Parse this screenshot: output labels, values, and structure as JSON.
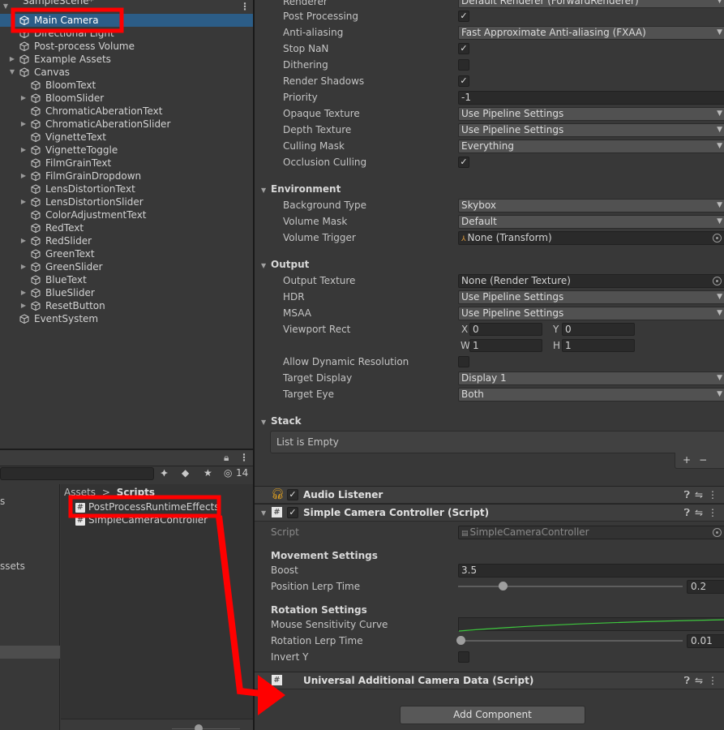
{
  "hierarchy": {
    "scene_name": "SampleScene*",
    "items": [
      {
        "label": "Main Camera"
      },
      {
        "label": "Directional Light"
      },
      {
        "label": "Post-process Volume"
      },
      {
        "label": "Example Assets"
      },
      {
        "label": "Canvas"
      },
      {
        "label": "BloomText"
      },
      {
        "label": "BloomSlider"
      },
      {
        "label": "ChromaticAberationText"
      },
      {
        "label": "ChromaticAberationSlider"
      },
      {
        "label": "VignetteText"
      },
      {
        "label": "VignetteToggle"
      },
      {
        "label": "FilmGrainText"
      },
      {
        "label": "FilmGrainDropdown"
      },
      {
        "label": "LensDistortionText"
      },
      {
        "label": "LensDistortionSlider"
      },
      {
        "label": "ColorAdjustmentText"
      },
      {
        "label": "RedText"
      },
      {
        "label": "RedSlider"
      },
      {
        "label": "GreenText"
      },
      {
        "label": "GreenSlider"
      },
      {
        "label": "BlueText"
      },
      {
        "label": "BlueSlider"
      },
      {
        "label": "ResetButton"
      },
      {
        "label": "EventSystem"
      }
    ]
  },
  "project": {
    "hidden_count": "14",
    "left_items": [
      "s",
      "ssets"
    ],
    "breadcrumb": {
      "root": "Assets",
      "sep": ">",
      "current": "Scripts"
    },
    "files": [
      "PostProcessRuntimeEffects",
      "SimpleCameraController"
    ]
  },
  "inspector": {
    "top_cut": "Default Renderer (ForwardRenderer)",
    "rendering": {
      "renderer_label": "Renderer",
      "post_processing": "Post Processing",
      "anti_aliasing": "Anti-aliasing",
      "anti_aliasing_value": "Fast Approximate Anti-aliasing (FXAA)",
      "stop_nan": "Stop NaN",
      "dithering": "Dithering",
      "render_shadows": "Render Shadows",
      "priority": "Priority",
      "priority_value": "-1",
      "opaque_texture": "Opaque Texture",
      "opaque_texture_value": "Use Pipeline Settings",
      "depth_texture": "Depth Texture",
      "depth_texture_value": "Use Pipeline Settings",
      "culling_mask": "Culling Mask",
      "culling_mask_value": "Everything",
      "occlusion_culling": "Occlusion Culling"
    },
    "environment": {
      "header": "Environment",
      "background_type": "Background Type",
      "background_type_value": "Skybox",
      "volume_mask": "Volume Mask",
      "volume_mask_value": "Default",
      "volume_trigger": "Volume Trigger",
      "volume_trigger_value": "None (Transform)"
    },
    "output": {
      "header": "Output",
      "output_texture": "Output Texture",
      "output_texture_value": "None (Render Texture)",
      "hdr": "HDR",
      "hdr_value": "Use Pipeline Settings",
      "msaa": "MSAA",
      "msaa_value": "Use Pipeline Settings",
      "viewport_rect": "Viewport Rect",
      "x": "X",
      "x_value": "0",
      "y": "Y",
      "y_value": "0",
      "w": "W",
      "w_value": "1",
      "h": "H",
      "h_value": "1",
      "allow_dynamic_resolution": "Allow Dynamic Resolution",
      "target_display": "Target Display",
      "target_display_value": "Display 1",
      "target_eye": "Target Eye",
      "target_eye_value": "Both"
    },
    "stack": {
      "header": "Stack",
      "empty_text": "List is Empty",
      "add": "+",
      "remove": "−"
    },
    "audio_listener": {
      "title": "Audio Listener"
    },
    "simple_camera": {
      "title": "Simple Camera Controller (Script)",
      "script_label": "Script",
      "script_value": "SimpleCameraController",
      "movement_settings": "Movement Settings",
      "boost": "Boost",
      "boost_value": "3.5",
      "position_lerp_time": "Position Lerp Time",
      "position_lerp_value": "0.2",
      "position_lerp_fraction": 0.2,
      "rotation_settings": "Rotation Settings",
      "mouse_sensitivity_curve": "Mouse Sensitivity Curve",
      "rotation_lerp_time": "Rotation Lerp Time",
      "rotation_lerp_value": "0.01",
      "rotation_lerp_fraction": 0.01,
      "invert_y": "Invert Y"
    },
    "universal_camera": {
      "title": "Universal Additional Camera Data (Script)"
    },
    "add_component": "Add Component"
  },
  "colors": {
    "selection": "#2c5d87",
    "annotation_red": "#ff0000",
    "curve_green": "#3ec83e"
  }
}
